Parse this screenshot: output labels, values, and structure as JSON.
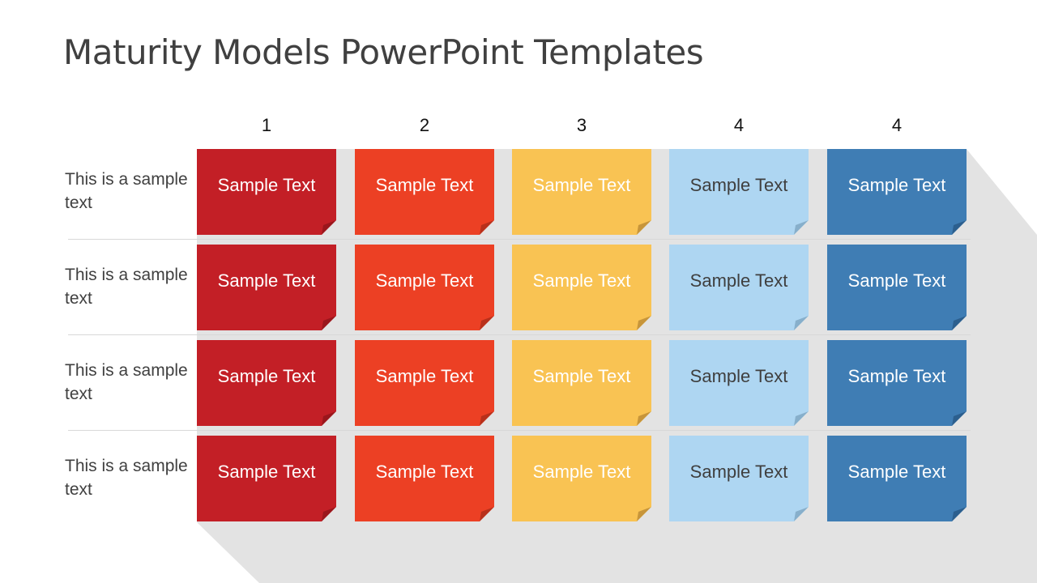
{
  "slide": {
    "title": "Maturity Models PowerPoint Templates"
  },
  "columns": [
    {
      "label": "1",
      "color": "#C31F26",
      "fold": "#9A161C",
      "text_color": "#FFFFFF"
    },
    {
      "label": "2",
      "color": "#EC4024",
      "fold": "#B8301B",
      "text_color": "#FFFFFF"
    },
    {
      "label": "3",
      "color": "#F9C353",
      "fold": "#C7953A",
      "text_color": "#FFFFFF"
    },
    {
      "label": "4",
      "color": "#AED6F2",
      "fold": "#87AFCB",
      "text_color": "#3F3F3F"
    },
    {
      "label": "4",
      "color": "#3F7DB4",
      "fold": "#2C5F8E",
      "text_color": "#FFFFFF"
    }
  ],
  "rows": [
    {
      "label": "This is a sample text",
      "cells": [
        "Sample Text",
        "Sample Text",
        "Sample Text",
        "Sample Text",
        "Sample Text"
      ]
    },
    {
      "label": "This is a sample text",
      "cells": [
        "Sample Text",
        "Sample Text",
        "Sample Text",
        "Sample Text",
        "Sample Text"
      ]
    },
    {
      "label": "This is a sample text",
      "cells": [
        "Sample Text",
        "Sample Text",
        "Sample Text",
        "Sample Text",
        "Sample Text"
      ]
    },
    {
      "label": "This is a sample text",
      "cells": [
        "Sample Text",
        "Sample Text",
        "Sample Text",
        "Sample Text",
        "Sample Text"
      ]
    }
  ],
  "colors": {
    "shadow": "#E3E3E3",
    "separator": "#D8D8D8",
    "title": "#404040"
  }
}
